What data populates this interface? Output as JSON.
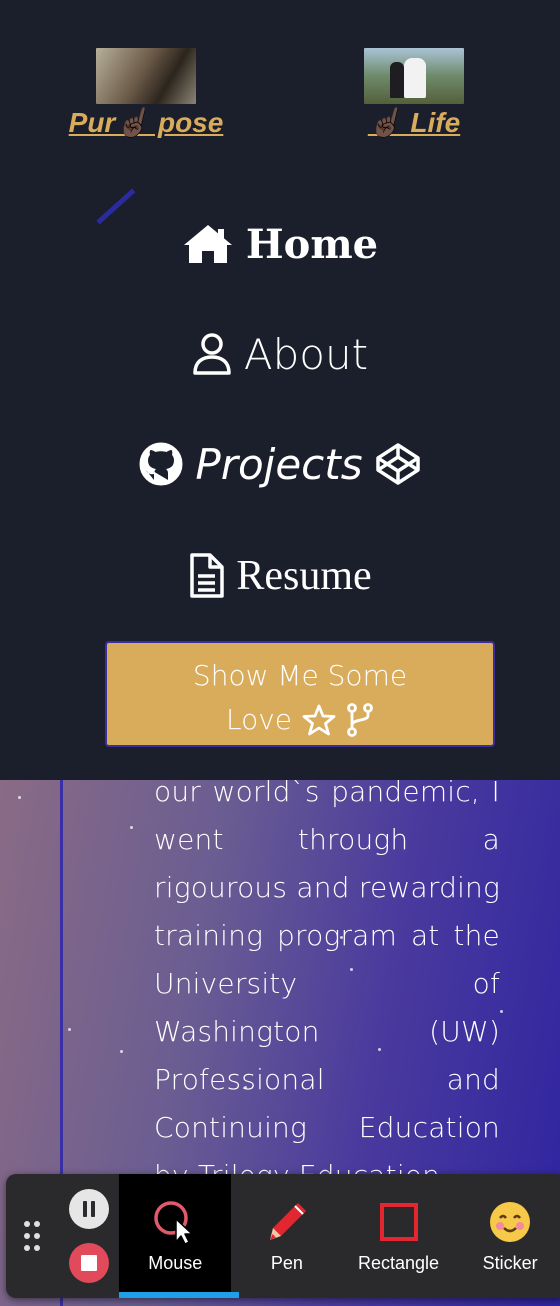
{
  "nav": {
    "top_links": [
      {
        "label": "Pur☝🏿 pose"
      },
      {
        "label": "☝🏿 Life"
      }
    ],
    "items": [
      {
        "label": "Home",
        "icon": "home-icon"
      },
      {
        "label": "About",
        "icon": "user-icon"
      },
      {
        "label": "Projects",
        "icon": "github-icon",
        "trailing_icon": "codepen-icon"
      },
      {
        "label": "Resume",
        "icon": "file-icon"
      }
    ],
    "love_button": {
      "line1": "Show Me Some",
      "line2": "Love",
      "icons": [
        "star-icon",
        "code-fork-icon"
      ]
    }
  },
  "content": {
    "paragraph": "our world`s pandemic, I went through a rigourous and rewarding training program at the University of Washington (UW) Professional and Continuing Education by Trilogy Education"
  },
  "toolbar": {
    "tools": [
      {
        "label": "Mouse",
        "icon": "mouse-cursor-icon",
        "active": true
      },
      {
        "label": "Pen",
        "icon": "pen-icon"
      },
      {
        "label": "Rectangle",
        "icon": "rectangle-icon"
      },
      {
        "label": "Sticker",
        "icon": "sticker-icon"
      }
    ]
  },
  "colors": {
    "nav_bg": "#1b1e2b",
    "accent_gold": "#d9ac5c",
    "border_purple": "#3b2fa0",
    "toolbar_bg": "#2a2a2c",
    "active_underline": "#1ea0e8",
    "stop_red": "#e04a5a"
  }
}
